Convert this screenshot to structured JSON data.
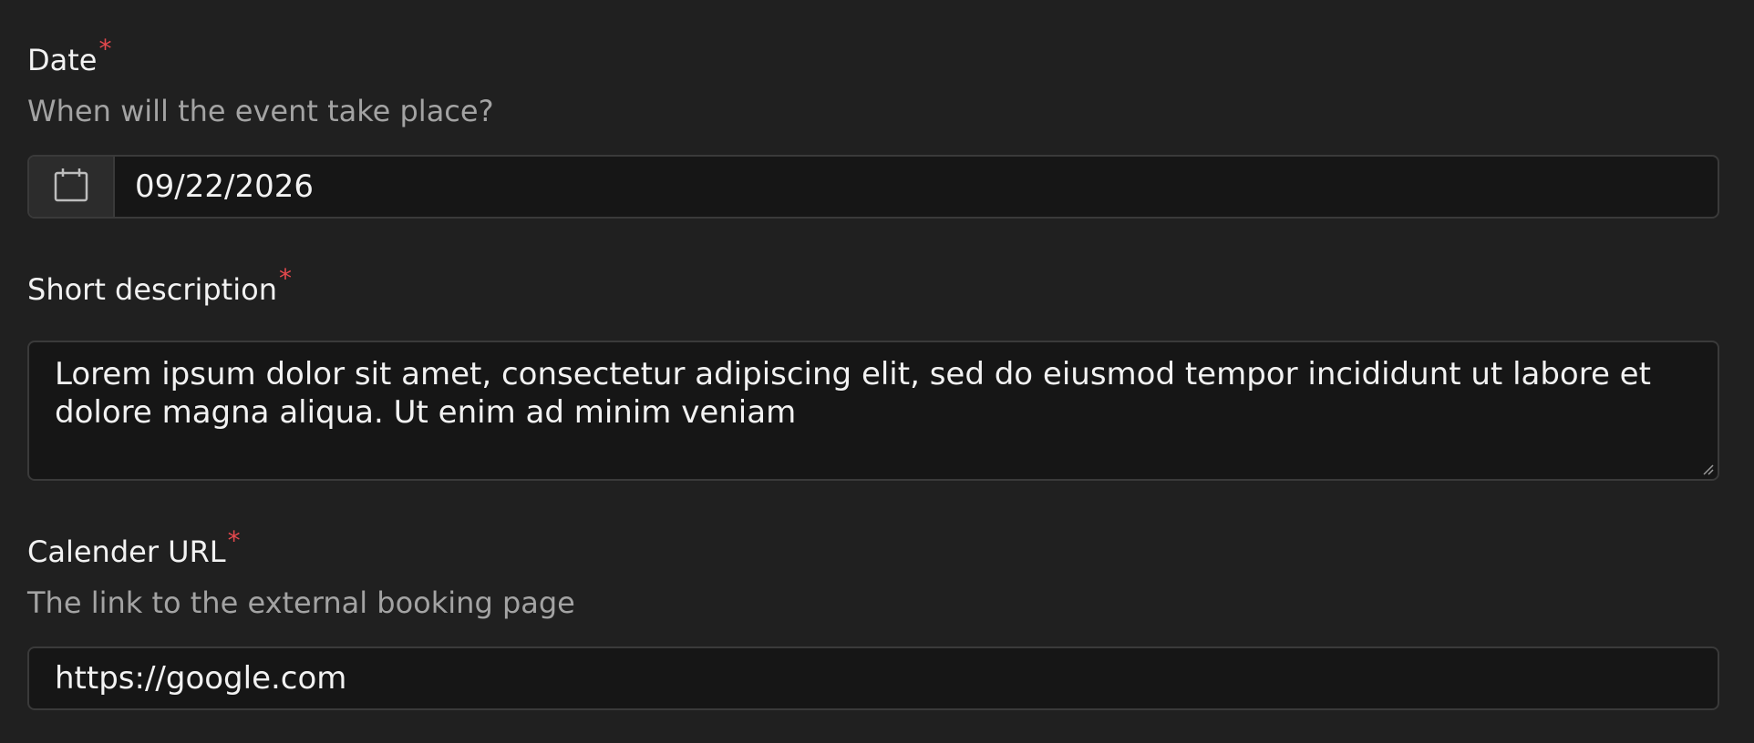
{
  "date_field": {
    "label": "Date",
    "required_mark": "*",
    "hint": "When will the event take place?",
    "value": "09/22/2026",
    "icon": "calendar-icon"
  },
  "description_field": {
    "label": "Short description",
    "required_mark": "*",
    "value": "Lorem ipsum dolor sit amet, consectetur adipiscing elit, sed do eiusmod tempor incididunt ut labore et dolore magna aliqua. Ut enim ad minim veniam"
  },
  "url_field": {
    "label": "Calender URL",
    "required_mark": "*",
    "hint": "The link to the external booking page",
    "value": "https://google.com"
  },
  "colors": {
    "background": "#202020",
    "input_background": "#161616",
    "border": "#3a3a3a",
    "required": "#e5484d",
    "hint": "#a3a3a3"
  }
}
